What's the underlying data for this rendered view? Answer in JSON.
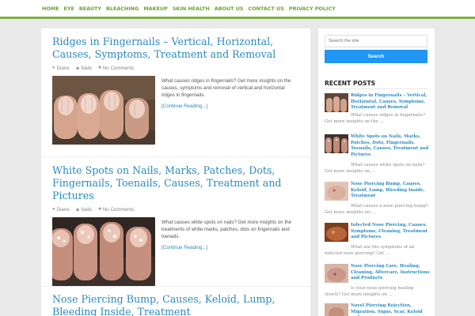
{
  "nav": {
    "items": [
      "HOME",
      "EYE",
      "BEAUTY",
      "BLEACHING",
      "MAKEUP",
      "SKIN HEALTH",
      "ABOUT US",
      "CONTACT US",
      "PRIVACY POLICY"
    ],
    "accent": "#7cb342"
  },
  "posts": [
    {
      "title": "Ridges in Fingernails – Vertical, Horizontal, Causes, Symptoms, Treatment and Removal",
      "author": "Diane",
      "category": "Nails",
      "comments": "No Comments",
      "excerpt": "What causes ridges in fingernails? Get more insights on the causes, symptoms and removal of vertical and horizontal ridges in fingernails.",
      "more": "[Continue Reading...]"
    },
    {
      "title": "White Spots on Nails, Marks, Patches, Dots, Fingernails, Toenails, Causes, Treatment and Pictures",
      "author": "Diane",
      "category": "Nails",
      "comments": "No Comments",
      "excerpt": "What causes white spots on nails? Get more insights on the treatments of white marks, patches, dots on fingernails and toenails.",
      "more": "[Continue Reading...]"
    },
    {
      "title": "Nose Piercing Bump, Causes, Keloid, Lump, Bleeding Inside, Treatment"
    }
  ],
  "sidebar": {
    "search_placeholder": "Search the site",
    "search_button": "Search",
    "recent_heading": "RECENT POSTS",
    "recent": [
      {
        "title": "Ridges in Fingernails – Vertical, Horizontal, Causes, Symptoms, Treatment and Removal",
        "excerpt": "What causes ridges in fingernails? Get more insights on the ..."
      },
      {
        "title": "White Spots on Nails, Marks, Patches, Dots, Fingernails, Toenails, Causes, Treatment and Pictures",
        "excerpt": "What causes white spots on nails? Get more insights on ..."
      },
      {
        "title": "Nose Piercing Bump, Causes, Keloid, Lump, Bleeding Inside, Treatment",
        "excerpt": "What causes a nose piercing bump? Get more insights on ..."
      },
      {
        "title": "Infected Nose Piercing, Causes, Symptoms, Cleaning, Treatment and Pictures",
        "excerpt": "What are the symptoms of an infected nose piercing? Get ..."
      },
      {
        "title": "Nose Piercing Care, Healing, Cleaning, Aftercare, Instructions and Products",
        "excerpt": "Is your nose piercing healing slowly? Get more insights on ..."
      },
      {
        "title": "Novel Piercing Rejection, Migration, Signs, Scar, Keloid and",
        "excerpt": ""
      }
    ]
  }
}
